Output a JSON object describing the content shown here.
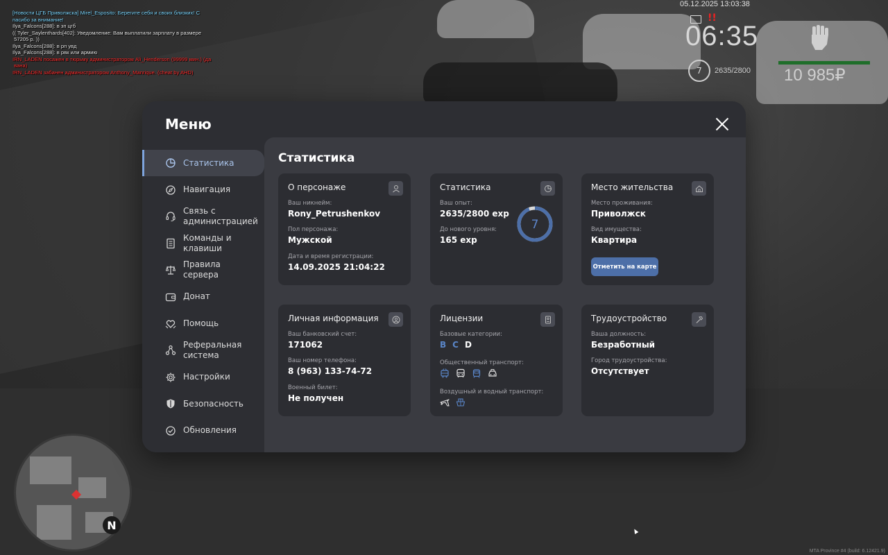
{
  "chat": [
    {
      "text": "[Новости ЦГБ Приволжска] Mirel_Esposito: Берегите себя и своих близких! С",
      "color": "#7fd8ff"
    },
    {
      "text": "пасибо за внимание!",
      "color": "#7fd8ff"
    },
    {
      "text": "Ilya_Falcons[288]: в зп цгб",
      "color": "#e6e6e6"
    },
    {
      "text": "(( Tyler_Saylenthards[402]: Уведомление: Вам выплатили зарплату в размере",
      "color": "#e6e6e6"
    },
    {
      "text": " 57205 р. ))",
      "color": "#e6e6e6"
    },
    {
      "text": "Ilya_Falcons[288]: в рп увд",
      "color": "#e6e6e6"
    },
    {
      "text": "Ilya_Falcons[288]: в рвк или армию",
      "color": "#e6e6e6"
    },
    {
      "text": "IRN_LADEN посажен в тюрьму администратором Ali_Henderson (99999 мин.) (да",
      "color": "#ff3030"
    },
    {
      "text": " вана)",
      "color": "#ff3030"
    },
    {
      "text": "IRN_LADEN забанен администратором Anthony_Manrique. (cheat by AHD)",
      "color": "#ff3030"
    }
  ],
  "hud": {
    "date": "05.12.2025 13:03:38",
    "time": "06:35",
    "level": "7",
    "exp": "2635/2800",
    "money": "10 985₽",
    "alert": "!!"
  },
  "build": "MTA Province #4 (build: 6.12421.9)",
  "menu": {
    "title": "Меню",
    "sidebar": [
      {
        "label": "Статистика",
        "icon": "pie-chart-icon",
        "active": true
      },
      {
        "label": "Навигация",
        "icon": "compass-icon"
      },
      {
        "label": "Связь с администрацией",
        "icon": "headset-icon"
      },
      {
        "label": "Команды и клавиши",
        "icon": "document-list-icon"
      },
      {
        "label": "Правила сервера",
        "icon": "scales-icon"
      },
      {
        "label": "Донат",
        "icon": "wallet-icon"
      },
      {
        "label": "Помощь",
        "icon": "heart-hands-icon"
      },
      {
        "label": "Реферальная система",
        "icon": "referral-network-icon"
      },
      {
        "label": "Настройки",
        "icon": "gear-icon"
      },
      {
        "label": "Безопасность",
        "icon": "shield-icon"
      },
      {
        "label": "Обновления",
        "icon": "update-check-icon"
      }
    ],
    "content_title": "Статистика",
    "character": {
      "title": "О персонаже",
      "nickname_label": "Ваш никнейм:",
      "nickname": "Rony_Petrushenkov",
      "gender_label": "Пол персонажа:",
      "gender": "Мужской",
      "reg_label": "Дата и время регистрации:",
      "reg": "14.09.2025 21:04:22"
    },
    "stats": {
      "title": "Статистика",
      "exp_label": "Ваш опыт:",
      "exp": "2635/2800 exp",
      "next_label": "До нового уровня:",
      "next": "165 exp",
      "level": "7",
      "progress": 0.941
    },
    "residence": {
      "title": "Место жительства",
      "place_label": "Место проживания:",
      "place": "Приволжск",
      "property_label": "Вид имущества:",
      "property": "Квартира",
      "map_button": "Отметить на карте"
    },
    "personal": {
      "title": "Личная информация",
      "bank_label": "Ваш банковский счет:",
      "bank": "171062",
      "phone_label": "Ваш номер телефона:",
      "phone": "8 (963) 133-74-72",
      "military_label": "Военный билет:",
      "military": "Не получен"
    },
    "licenses": {
      "title": "Лицензии",
      "base_label": "Базовые категории:",
      "base": [
        {
          "letter": "B",
          "color": "#5a86c9"
        },
        {
          "letter": "C",
          "color": "#5a86c9"
        },
        {
          "letter": "D",
          "color": "#ffffff"
        }
      ],
      "public_label": "Общественный транспорт:",
      "air_label": "Воздушный и водный транспорт:"
    },
    "job": {
      "title": "Трудоустройство",
      "position_label": "Ваша должность:",
      "position": "Безработный",
      "city_label": "Город трудоустройства:",
      "city": "Отсутствует"
    }
  }
}
